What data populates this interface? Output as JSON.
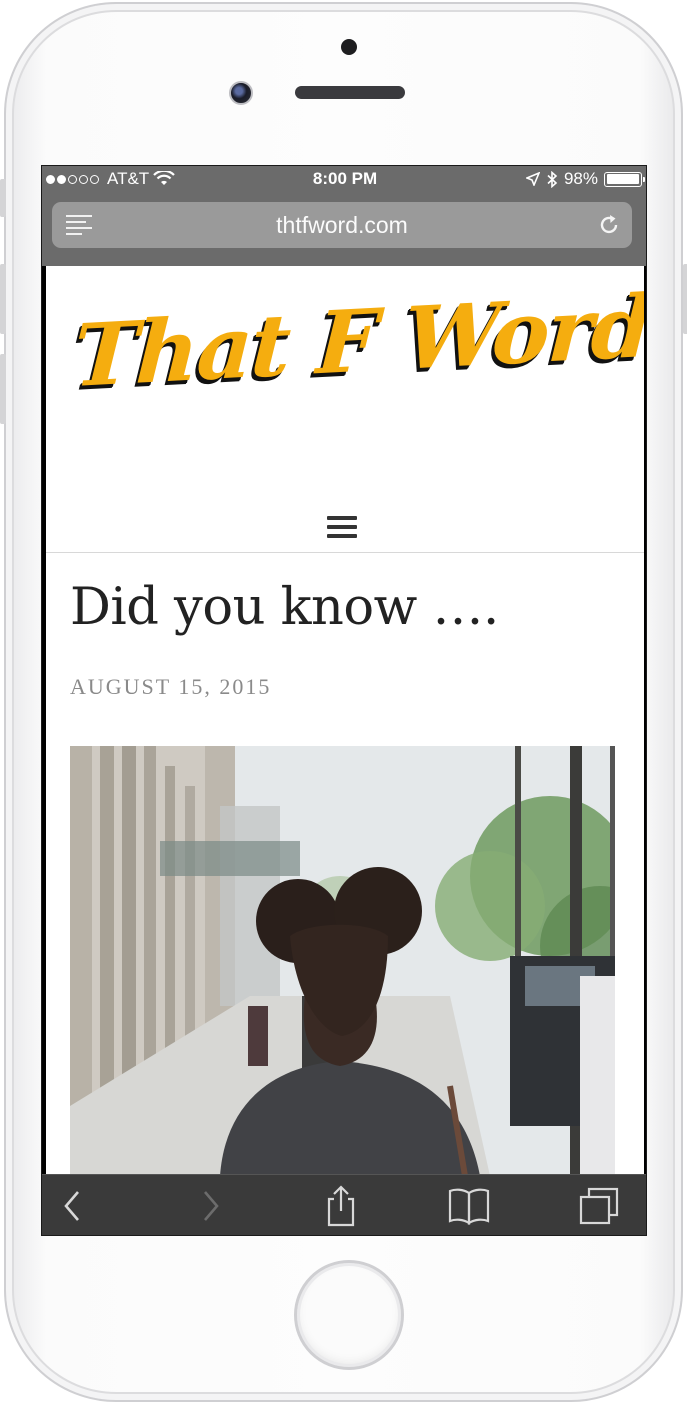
{
  "status_bar": {
    "carrier": "AT&T",
    "time": "8:00 PM",
    "battery": "98%",
    "battery_level": 0.98,
    "signal_bars_filled": 2,
    "signal_bars_total": 5
  },
  "browser": {
    "url": "thtfword.com",
    "icons": {
      "reader": "reader-icon",
      "reload": "reload-icon",
      "back": "chevron-left-icon",
      "forward": "chevron-right-icon",
      "share": "share-icon",
      "bookmarks": "book-icon",
      "tabs": "tabs-icon"
    }
  },
  "site": {
    "logo_text": "That F Word",
    "logo_color": "#f5ad0f",
    "menu_icon": "hamburger-menu-icon"
  },
  "post": {
    "title": "Did you know ….",
    "date": "AUGUST 15, 2015",
    "image": "street-photo"
  }
}
